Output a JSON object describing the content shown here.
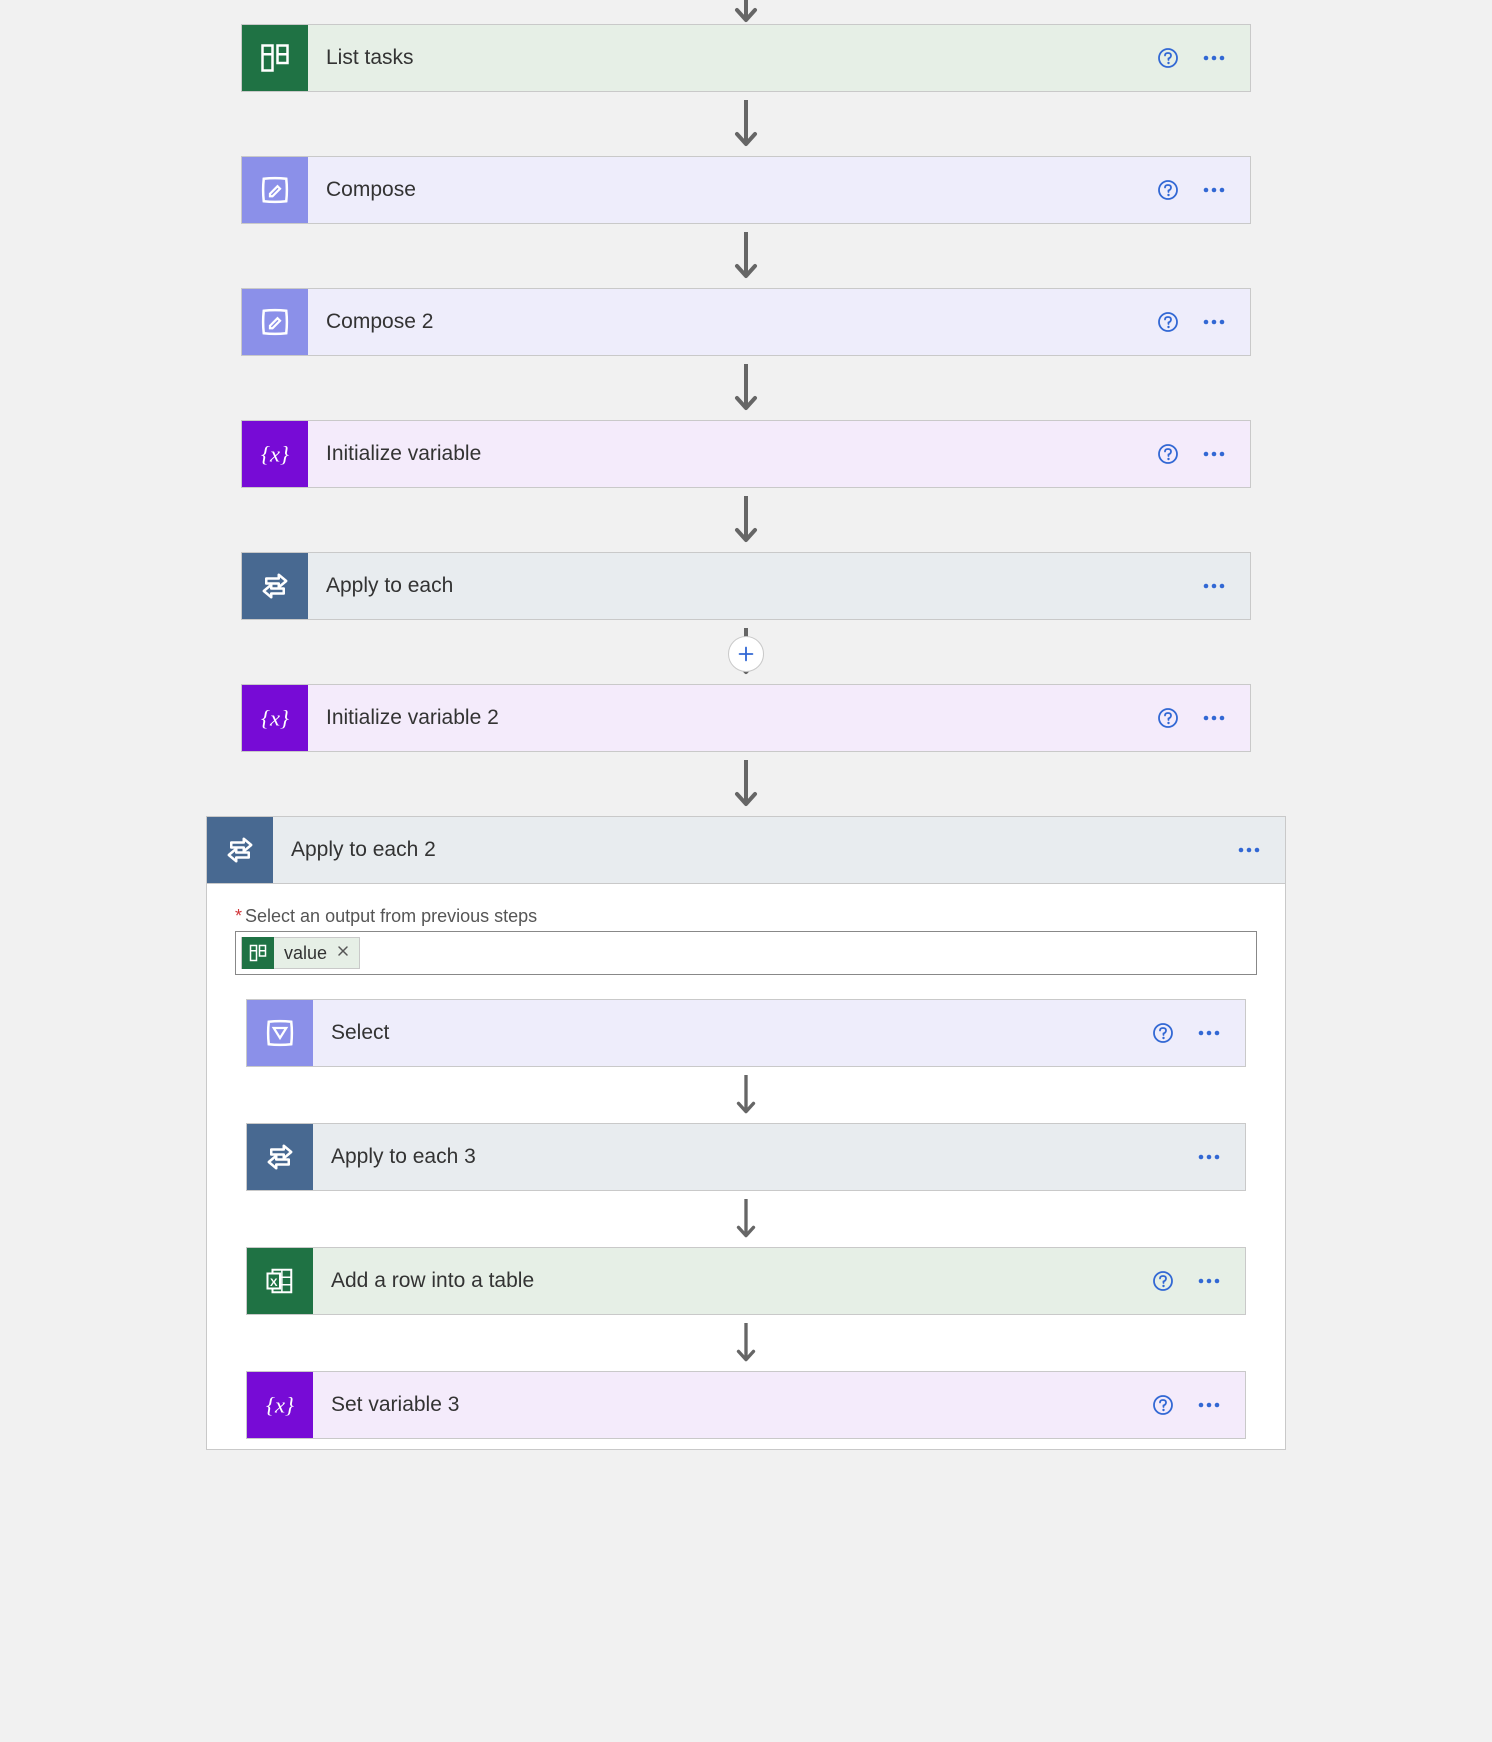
{
  "topSteps": [
    {
      "id": "list-tasks",
      "label": "List tasks",
      "iconType": "planner",
      "bodyClass": "body-green",
      "hasHelp": true
    },
    {
      "id": "compose",
      "label": "Compose",
      "iconType": "compose",
      "bodyClass": "body-lavender",
      "hasHelp": true
    },
    {
      "id": "compose-2",
      "label": "Compose 2",
      "iconType": "compose",
      "bodyClass": "body-lavender",
      "hasHelp": true
    },
    {
      "id": "init-var",
      "label": "Initialize variable",
      "iconType": "variable",
      "bodyClass": "body-purple",
      "hasHelp": true
    },
    {
      "id": "apply-each",
      "label": "Apply to each",
      "iconType": "control",
      "bodyClass": "body-grey",
      "hasHelp": false
    },
    {
      "id": "init-var-2",
      "label": "Initialize variable 2",
      "iconType": "variable",
      "bodyClass": "body-purple",
      "hasHelp": true
    }
  ],
  "arrowPlusAfterIndex": 4,
  "container": {
    "title": "Apply to each 2",
    "field": {
      "label": "Select an output from previous steps",
      "token": {
        "label": "value",
        "iconType": "planner"
      }
    },
    "innerSteps": [
      {
        "id": "select",
        "label": "Select",
        "iconType": "select",
        "bodyClass": "body-lavender",
        "hasHelp": true
      },
      {
        "id": "apply-each-3",
        "label": "Apply to each 3",
        "iconType": "control",
        "bodyClass": "body-grey",
        "hasHelp": false
      },
      {
        "id": "add-row",
        "label": "Add a row into a table",
        "iconType": "excel",
        "bodyClass": "body-green",
        "hasHelp": true
      },
      {
        "id": "set-var-3",
        "label": "Set variable 3",
        "iconType": "variable",
        "bodyClass": "body-purple",
        "hasHelp": true
      }
    ]
  }
}
